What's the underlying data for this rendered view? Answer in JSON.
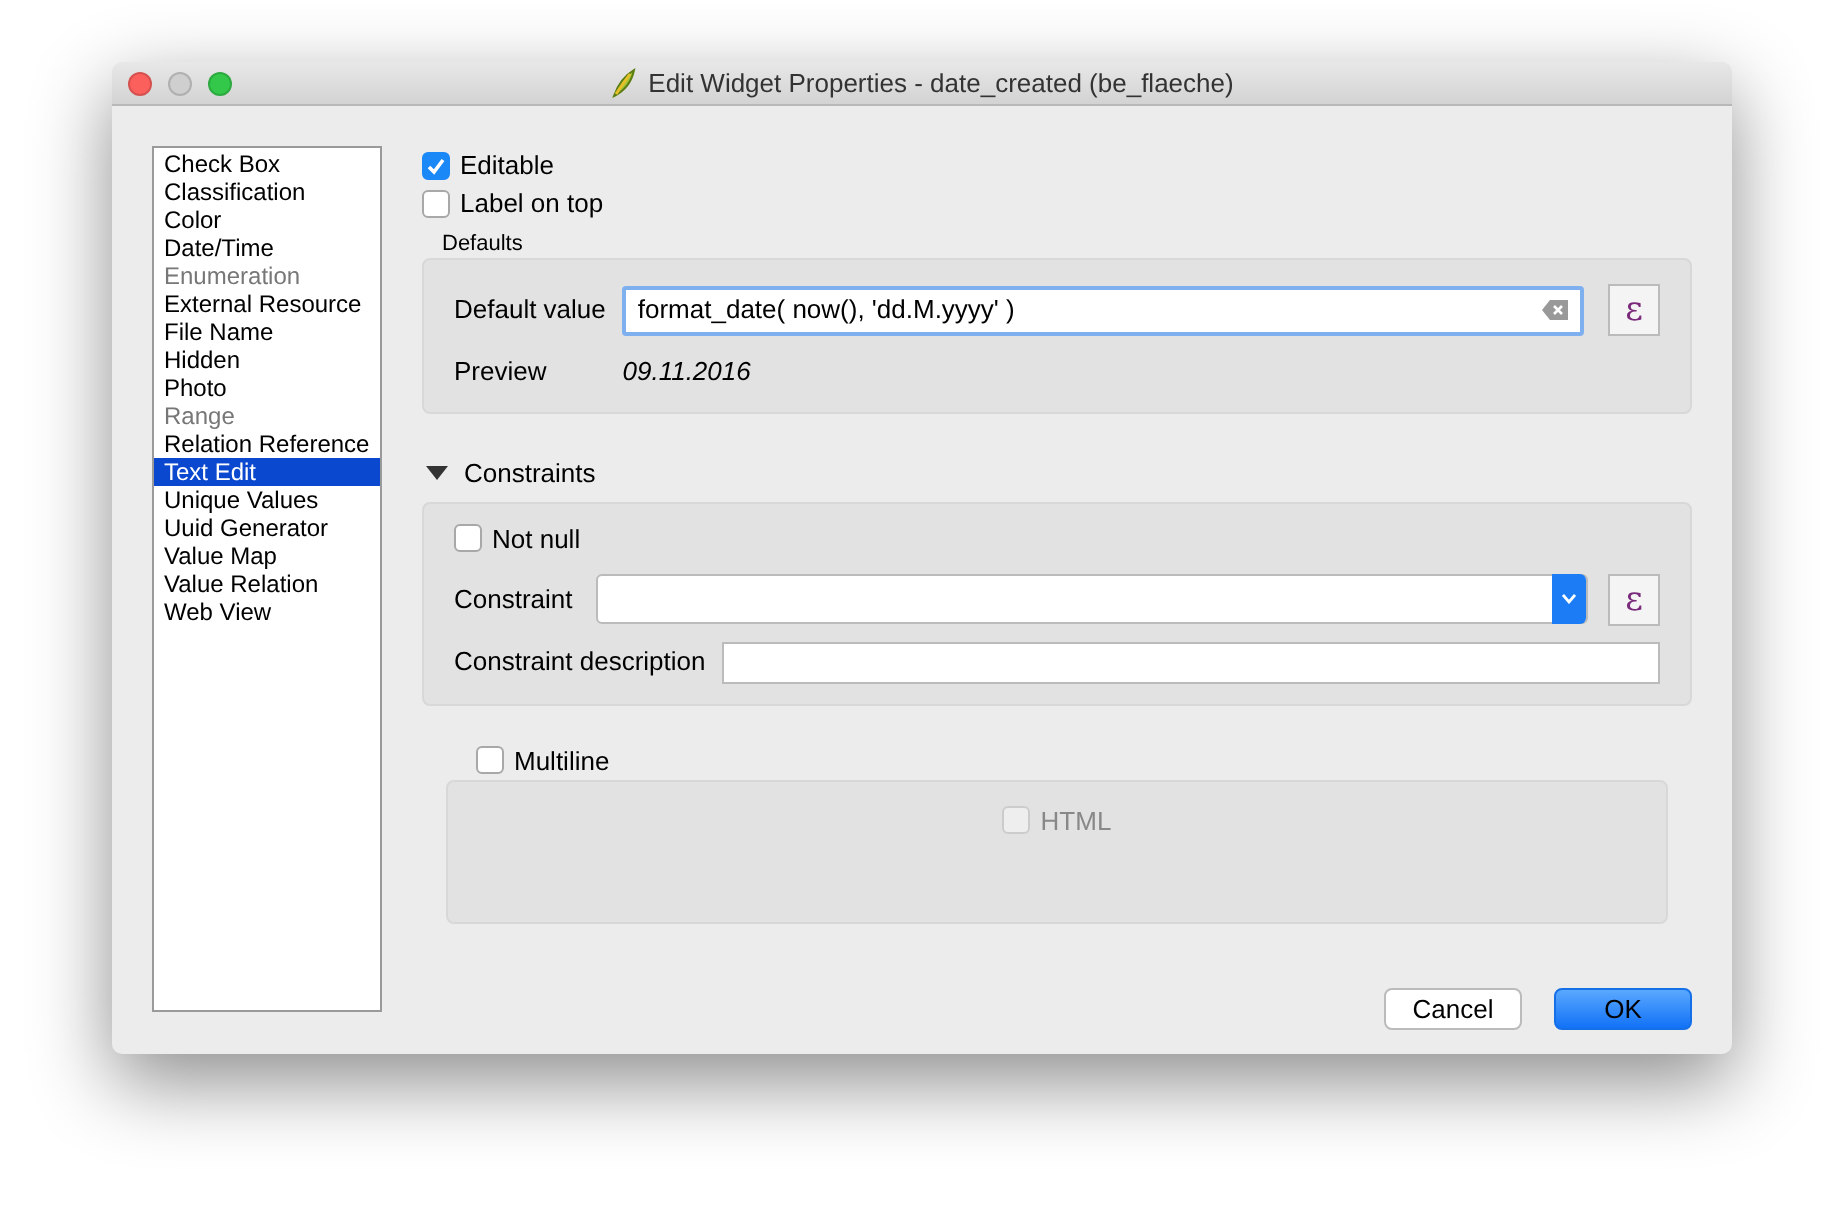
{
  "window": {
    "title": "Edit Widget Properties - date_created (be_flaeche)"
  },
  "widget_types": [
    {
      "label": "Check Box",
      "disabled": false,
      "selected": false
    },
    {
      "label": "Classification",
      "disabled": false,
      "selected": false
    },
    {
      "label": "Color",
      "disabled": false,
      "selected": false
    },
    {
      "label": "Date/Time",
      "disabled": false,
      "selected": false
    },
    {
      "label": "Enumeration",
      "disabled": true,
      "selected": false
    },
    {
      "label": "External Resource",
      "disabled": false,
      "selected": false
    },
    {
      "label": "File Name",
      "disabled": false,
      "selected": false
    },
    {
      "label": "Hidden",
      "disabled": false,
      "selected": false
    },
    {
      "label": "Photo",
      "disabled": false,
      "selected": false
    },
    {
      "label": "Range",
      "disabled": true,
      "selected": false
    },
    {
      "label": "Relation Reference",
      "disabled": false,
      "selected": false
    },
    {
      "label": "Text Edit",
      "disabled": false,
      "selected": true
    },
    {
      "label": "Unique Values",
      "disabled": false,
      "selected": false
    },
    {
      "label": "Uuid Generator",
      "disabled": false,
      "selected": false
    },
    {
      "label": "Value Map",
      "disabled": false,
      "selected": false
    },
    {
      "label": "Value Relation",
      "disabled": false,
      "selected": false
    },
    {
      "label": "Web View",
      "disabled": false,
      "selected": false
    }
  ],
  "editable": {
    "label": "Editable",
    "checked": true
  },
  "label_on_top": {
    "label": "Label on top",
    "checked": false
  },
  "defaults": {
    "title": "Defaults",
    "default_value_label": "Default value",
    "default_value": "format_date( now(), 'dd.M.yyyy' )",
    "expression_button": "ε",
    "preview_label": "Preview",
    "preview": "09.11.2016"
  },
  "constraints": {
    "title": "Constraints",
    "expanded": true,
    "not_null": {
      "label": "Not null",
      "checked": false
    },
    "constraint_label": "Constraint",
    "expression_button": "ε",
    "description_label": "Constraint description"
  },
  "multiline": {
    "label": "Multiline",
    "checked": false,
    "html": {
      "label": "HTML",
      "checked": false,
      "disabled": true
    }
  },
  "buttons": [
    {
      "label": "Cancel",
      "kind": "normal"
    },
    {
      "label": "OK",
      "kind": "default"
    }
  ]
}
